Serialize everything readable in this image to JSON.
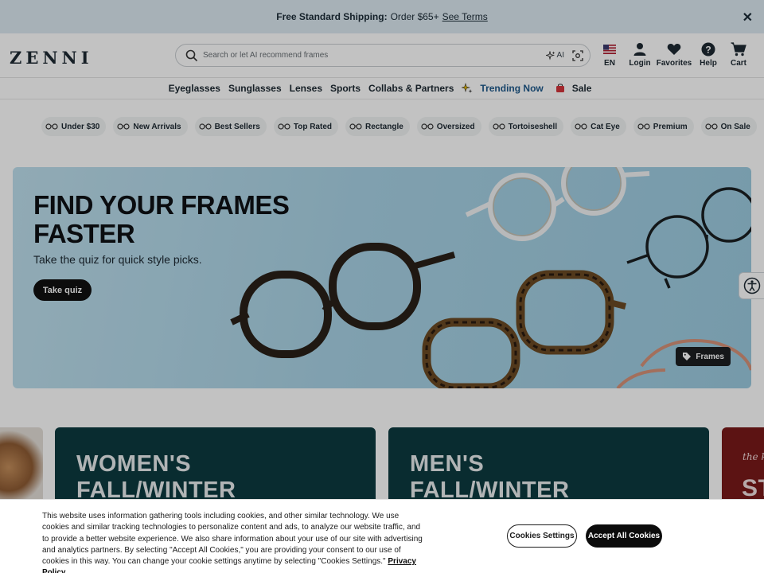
{
  "promo": {
    "bold": "Free Standard Shipping:",
    "text": "Order $65+",
    "link": "See Terms",
    "close": "✕"
  },
  "header": {
    "logo": "ZENNI",
    "search_placeholder": "Search or let AI recommend frames",
    "ai_label": "AI",
    "icons": [
      {
        "label": "EN",
        "icon": "us-flag-icon"
      },
      {
        "label": "Login",
        "icon": "user-icon"
      },
      {
        "label": "Favorites",
        "icon": "heart-icon"
      },
      {
        "label": "Help",
        "icon": "help-icon"
      },
      {
        "label": "Cart",
        "icon": "cart-icon"
      }
    ]
  },
  "nav": {
    "items": [
      "Eyeglasses",
      "Sunglasses",
      "Lenses",
      "Sports",
      "Collabs & Partners"
    ],
    "trending": "Trending Now",
    "sale": "Sale",
    "trending_color": "#1f5a8c"
  },
  "chips": [
    "Under $30",
    "New Arrivals",
    "Best Sellers",
    "Top Rated",
    "Rectangle",
    "Oversized",
    "Tortoiseshell",
    "Cat Eye",
    "Premium",
    "On Sale"
  ],
  "hero": {
    "title_line1": "FIND YOUR FRAMES",
    "title_line2": "FASTER",
    "subtitle": "Take the quiz for quick style picks.",
    "cta": "Take quiz",
    "tag": "Frames"
  },
  "cards": {
    "women_l1": "WOMEN'S",
    "women_l2": "FALL/WINTER",
    "men_l1": "MEN'S",
    "men_l2": "FALL/WINTER",
    "right_script": "the k",
    "right_big": "ST"
  },
  "cookie": {
    "text": "This website uses information gathering tools including cookies, and other similar technology. We use cookies and similar tracking technologies to personalize content and ads, to analyze our website traffic, and to provide a better website experience. We also share information about your use of our site with advertising and analytics partners. By selecting \"Accept All Cookies,\" you are providing your consent to our use of cookies in this way. You can change your cookie settings anytime by selecting \"Cookies Settings.\"",
    "policy_link": "Privacy Policy",
    "settings_btn": "Cookies Settings",
    "accept_btn": "Accept All Cookies"
  }
}
